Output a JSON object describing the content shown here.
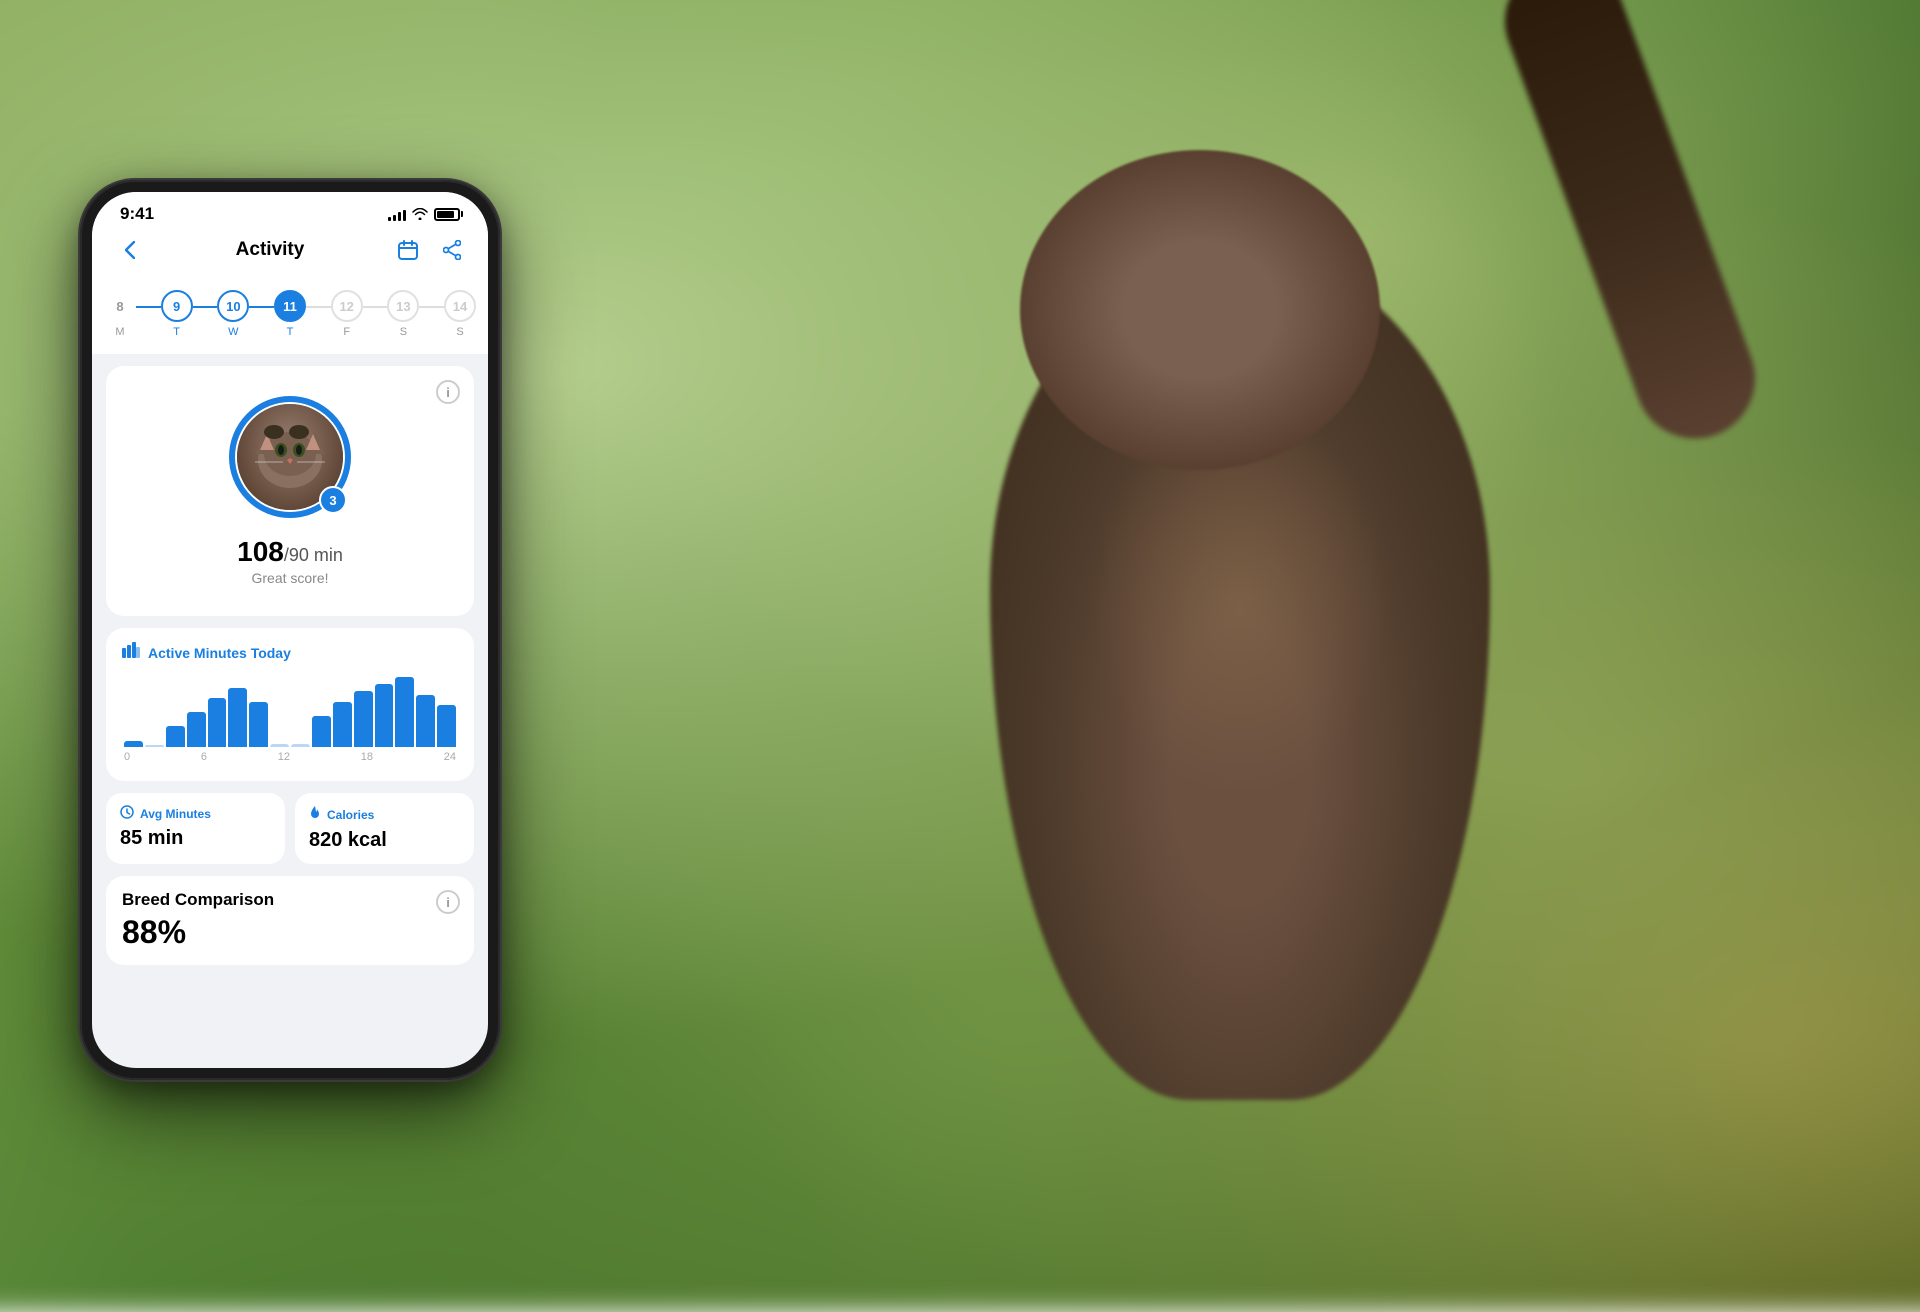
{
  "background": {
    "description": "Blurred outdoor garden with grass and trees"
  },
  "phone": {
    "status_bar": {
      "time": "9:41",
      "signal_bars": [
        3,
        5,
        7,
        9,
        11
      ],
      "wifi": "wifi",
      "battery_percent": 85
    },
    "nav": {
      "back_icon": "chevron-left",
      "title": "Activity",
      "calendar_icon": "calendar",
      "share_icon": "share"
    },
    "day_selector": {
      "days": [
        {
          "number": "8",
          "label": "M",
          "state": "inactive"
        },
        {
          "number": "9",
          "label": "T",
          "state": "connected"
        },
        {
          "number": "10",
          "label": "W",
          "state": "connected"
        },
        {
          "number": "11",
          "label": "T",
          "state": "active"
        },
        {
          "number": "12",
          "label": "F",
          "state": "disabled"
        },
        {
          "number": "13",
          "label": "S",
          "state": "disabled"
        },
        {
          "number": "14",
          "label": "S",
          "state": "disabled"
        }
      ]
    },
    "activity_card": {
      "info_button": "i",
      "score": "108",
      "target": "/90 min",
      "label": "Great score!",
      "badge": "3"
    },
    "chart_card": {
      "title": "Active Minutes Today",
      "title_icon": "bar-chart",
      "bars": [
        2,
        0,
        15,
        30,
        45,
        55,
        40,
        0,
        0,
        25,
        40,
        55,
        65,
        70,
        50,
        40
      ],
      "x_labels": [
        "0",
        "6",
        "12",
        "18",
        "24"
      ]
    },
    "stats": [
      {
        "icon": "clock",
        "label": "Avg Minutes",
        "value": "85 min"
      },
      {
        "icon": "flame",
        "label": "Calories",
        "value": "820 kcal"
      }
    ],
    "breed_comparison": {
      "title": "Breed Comparison",
      "percent": "88%",
      "info_button": "i"
    }
  },
  "colors": {
    "accent": "#1a7fe0",
    "background": "#f0f2f5",
    "text_primary": "#000000",
    "text_secondary": "#888888",
    "white": "#ffffff"
  }
}
